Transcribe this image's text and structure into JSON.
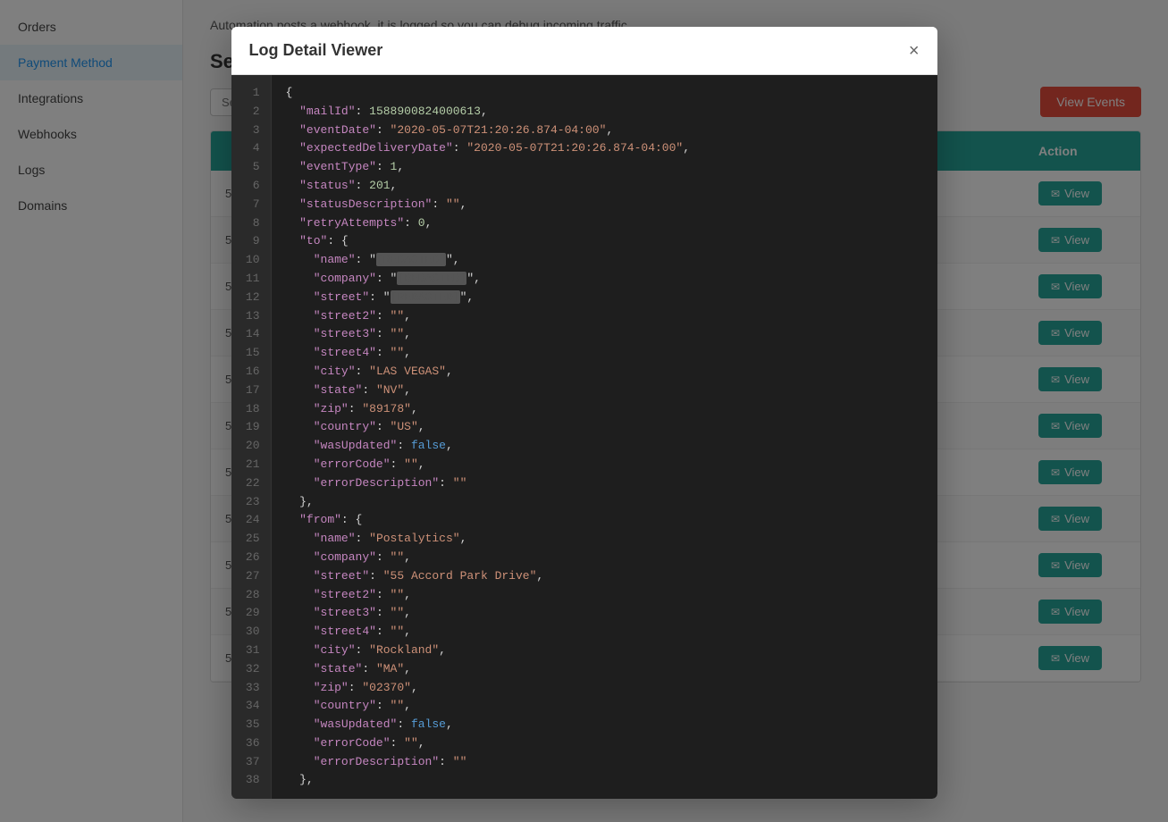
{
  "sidebar": {
    "items": [
      {
        "label": "Orders",
        "id": "orders",
        "active": false
      },
      {
        "label": "Payment Method",
        "id": "payment-method",
        "active": true
      },
      {
        "label": "Integrations",
        "id": "integrations",
        "active": false
      },
      {
        "label": "Webhooks",
        "id": "webhooks",
        "active": false
      },
      {
        "label": "Logs",
        "id": "logs",
        "active": false
      },
      {
        "label": "Domains",
        "id": "domains",
        "active": false
      }
    ]
  },
  "main": {
    "description": "Automation posts a webhook, it is logged so you can debug incoming traffic.",
    "section_title": "Se...",
    "search_placeholder": "Se...",
    "view_events_label": "View Events",
    "table": {
      "columns": [
        "Action"
      ],
      "rows": [
        {
          "id": "5",
          "action": "View"
        },
        {
          "id": "5",
          "action": "View"
        },
        {
          "id": "5",
          "action": "View"
        },
        {
          "id": "5",
          "action": "View"
        },
        {
          "id": "5",
          "action": "View"
        },
        {
          "id": "5",
          "action": "View"
        },
        {
          "id": "5",
          "action": "View"
        },
        {
          "id": "5",
          "action": "View"
        },
        {
          "id": "5",
          "action": "View"
        },
        {
          "id": "5",
          "action": "View"
        },
        {
          "id": "5",
          "action": "View"
        }
      ]
    }
  },
  "modal": {
    "title": "Log Detail Viewer",
    "close_label": "×",
    "code_lines": [
      {
        "num": 1,
        "content": "{"
      },
      {
        "num": 2,
        "content": "  \"mailId\": 1588900824000613,"
      },
      {
        "num": 3,
        "content": "  \"eventDate\": \"2020-05-07T21:20:26.874-04:00\","
      },
      {
        "num": 4,
        "content": "  \"expectedDeliveryDate\": \"2020-05-07T21:20:26.874-04:00\","
      },
      {
        "num": 5,
        "content": "  \"eventType\": 1,"
      },
      {
        "num": 6,
        "content": "  \"status\": 201,"
      },
      {
        "num": 7,
        "content": "  \"statusDescription\": \"\","
      },
      {
        "num": 8,
        "content": "  \"retryAttempts\": 0,"
      },
      {
        "num": 9,
        "content": "  \"to\": {"
      },
      {
        "num": 10,
        "content": "    \"name\": \"[REDACTED]\","
      },
      {
        "num": 11,
        "content": "    \"company\": \"[REDACTED]\","
      },
      {
        "num": 12,
        "content": "    \"street\": \"[REDACTED]\","
      },
      {
        "num": 13,
        "content": "    \"street2\": \"\","
      },
      {
        "num": 14,
        "content": "    \"street3\": \"\","
      },
      {
        "num": 15,
        "content": "    \"street4\": \"\","
      },
      {
        "num": 16,
        "content": "    \"city\": \"LAS VEGAS\","
      },
      {
        "num": 17,
        "content": "    \"state\": \"NV\","
      },
      {
        "num": 18,
        "content": "    \"zip\": \"89178\","
      },
      {
        "num": 19,
        "content": "    \"country\": \"US\","
      },
      {
        "num": 20,
        "content": "    \"wasUpdated\": false,"
      },
      {
        "num": 21,
        "content": "    \"errorCode\": \"\","
      },
      {
        "num": 22,
        "content": "    \"errorDescription\": \"\""
      },
      {
        "num": 23,
        "content": "  },"
      },
      {
        "num": 24,
        "content": "  \"from\": {"
      },
      {
        "num": 25,
        "content": "    \"name\": \"Postalytics\","
      },
      {
        "num": 26,
        "content": "    \"company\": \"\","
      },
      {
        "num": 27,
        "content": "    \"street\": \"55 Accord Park Drive\","
      },
      {
        "num": 28,
        "content": "    \"street2\": \"\","
      },
      {
        "num": 29,
        "content": "    \"street3\": \"\","
      },
      {
        "num": 30,
        "content": "    \"street4\": \"\","
      },
      {
        "num": 31,
        "content": "    \"city\": \"Rockland\","
      },
      {
        "num": 32,
        "content": "    \"state\": \"MA\","
      },
      {
        "num": 33,
        "content": "    \"zip\": \"02370\","
      },
      {
        "num": 34,
        "content": "    \"country\": \"\","
      },
      {
        "num": 35,
        "content": "    \"wasUpdated\": false,"
      },
      {
        "num": 36,
        "content": "    \"errorCode\": \"\","
      },
      {
        "num": 37,
        "content": "    \"errorDescription\": \"\""
      },
      {
        "num": 38,
        "content": "  },"
      }
    ]
  }
}
